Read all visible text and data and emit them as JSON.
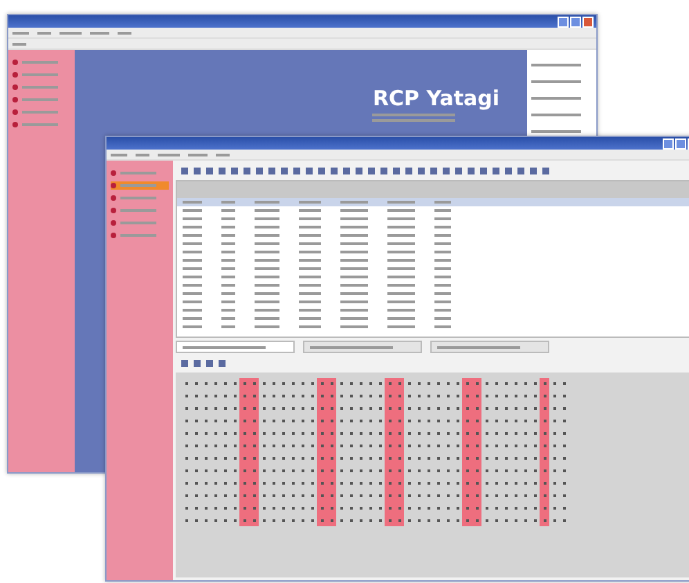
{
  "back_window": {
    "logo_title": "RCP Yatagi",
    "sidebar_items": [
      {
        "selected": false
      },
      {
        "selected": false
      },
      {
        "selected": false
      },
      {
        "selected": false
      },
      {
        "selected": false
      },
      {
        "selected": false
      }
    ]
  },
  "front_window": {
    "sidebar_items": [
      {
        "selected": false
      },
      {
        "selected": true
      },
      {
        "selected": false
      },
      {
        "selected": false
      },
      {
        "selected": false
      },
      {
        "selected": false
      }
    ],
    "tabs": [
      {
        "selected": true
      },
      {
        "selected": false
      },
      {
        "selected": false
      }
    ],
    "seat_columns": [
      {
        "selected": false
      },
      {
        "selected": false
      },
      {
        "selected": false
      },
      {
        "selected": false
      },
      {
        "selected": false
      },
      {
        "selected": false
      },
      {
        "selected": true
      },
      {
        "selected": true
      },
      {
        "selected": false
      },
      {
        "selected": false
      },
      {
        "selected": false
      },
      {
        "selected": false
      },
      {
        "selected": false
      },
      {
        "selected": false
      },
      {
        "selected": true
      },
      {
        "selected": true
      },
      {
        "selected": false
      },
      {
        "selected": false
      },
      {
        "selected": false
      },
      {
        "selected": false
      },
      {
        "selected": false
      },
      {
        "selected": true
      },
      {
        "selected": true
      },
      {
        "selected": false
      },
      {
        "selected": false
      },
      {
        "selected": false
      },
      {
        "selected": false
      },
      {
        "selected": false
      },
      {
        "selected": false
      },
      {
        "selected": true
      },
      {
        "selected": true
      },
      {
        "selected": false
      },
      {
        "selected": false
      },
      {
        "selected": false
      },
      {
        "selected": false
      },
      {
        "selected": false
      },
      {
        "selected": false
      },
      {
        "selected": true
      },
      {
        "selected": false
      },
      {
        "selected": false
      }
    ]
  }
}
